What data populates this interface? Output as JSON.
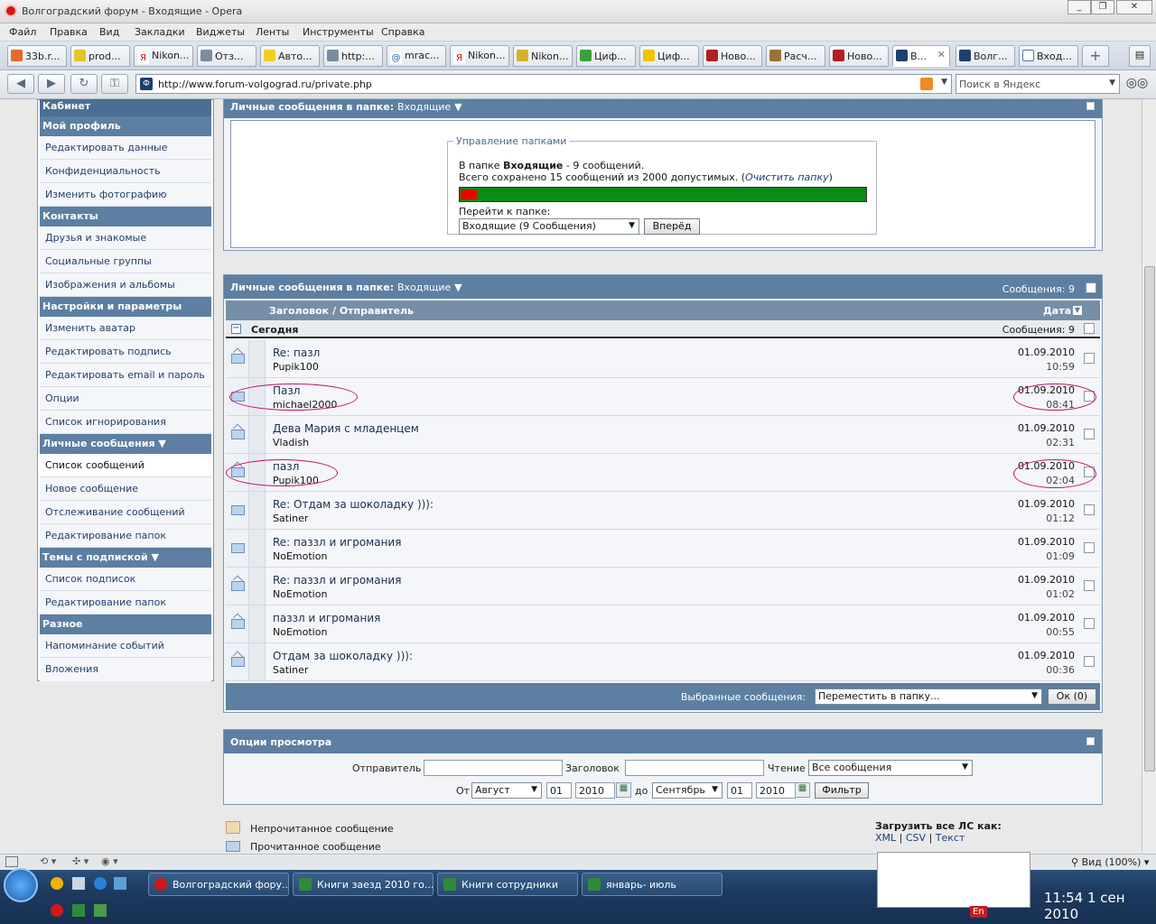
{
  "window": {
    "title": "Волгоградский форум - Входящие - Opera"
  },
  "menu": [
    "Файл",
    "Правка",
    "Вид",
    "Закладки",
    "Виджеты",
    "Ленты",
    "Инструменты",
    "Справка"
  ],
  "tabs": [
    "33b.r...",
    "prod...",
    "Nikon...",
    "Отз...",
    "Авто...",
    "http:...",
    "mrac...",
    "Nikon...",
    "Nikon...",
    "Циф...",
    "Циф...",
    "Ново...",
    "Расч...",
    "Ново...",
    "В...",
    "Волг...",
    "Вход..."
  ],
  "address": {
    "url": "http://www.forum-volgograd.ru/private.php",
    "search_placeholder": "Поиск в Яндекс"
  },
  "sidebar": {
    "sections": [
      {
        "title": "Кабинет"
      },
      {
        "title": "Мой профиль",
        "items": [
          "Редактировать данные",
          "Конфиденциальность",
          "Изменить фотографию"
        ]
      },
      {
        "title": "Контакты",
        "items": [
          "Друзья и знакомые",
          "Социальные группы",
          "Изображения и альбомы"
        ]
      },
      {
        "title": "Настройки и параметры",
        "items": [
          "Изменить аватар",
          "Редактировать подпись",
          "Редактировать email и пароль",
          "Опции",
          "Список игнорирования"
        ]
      },
      {
        "title": "Личные сообщения",
        "items": [
          "Список сообщений",
          "Новое сообщение",
          "Отслеживание сообщений",
          "Редактирование папок"
        ]
      },
      {
        "title": "Темы с подпиской",
        "items": [
          "Список подписок",
          "Редактирование папок"
        ]
      },
      {
        "title": "Разное",
        "items": [
          "Напоминание событий",
          "Вложения"
        ]
      }
    ]
  },
  "folder_mgmt": {
    "header_label": "Личные сообщения в папке:",
    "header_folder": "Входящие",
    "legend": "Управление папками",
    "line1_pre": "В папке ",
    "line1_bold": "Входящие",
    "line1_post": " - 9 сообщений.",
    "line2_pre": "Всего сохранено 15 сообщений из 2000 допустимых. (",
    "line2_link": "Очистить папку",
    "line2_post": ")",
    "usage_fraction": 0.0075,
    "goto_label": "Перейти к папке:",
    "goto_select": "Входящие (9 Сообщения)",
    "goto_button": "Вперёд"
  },
  "messages": {
    "header_label": "Личные сообщения в папке:",
    "header_folder": "Входящие",
    "count_label": "Сообщения: 9",
    "col_title": "Заголовок / Отправитель",
    "col_date": "Дата",
    "group_label": "Сегодня",
    "group_count": "Сообщения: 9",
    "rows": [
      {
        "title": "Re: пазл",
        "sender": "Pupik100",
        "date": "01.09.2010",
        "time": "10:59"
      },
      {
        "title": "Пазл",
        "sender": "michael2000",
        "date": "01.09.2010",
        "time": "08:41"
      },
      {
        "title": "Дева Мария с младенцем",
        "sender": "Vladish",
        "date": "01.09.2010",
        "time": "02:31"
      },
      {
        "title": "пазл",
        "sender": "Pupik100",
        "date": "01.09.2010",
        "time": "02:04"
      },
      {
        "title": "Re: Отдам за шоколадку ))):",
        "sender": "Satiner",
        "date": "01.09.2010",
        "time": "01:12"
      },
      {
        "title": "Re: паззл и игромания",
        "sender": "NoEmotion",
        "date": "01.09.2010",
        "time": "01:09"
      },
      {
        "title": "Re: паззл и игромания",
        "sender": "NoEmotion",
        "date": "01.09.2010",
        "time": "01:02"
      },
      {
        "title": "паззл и игромания",
        "sender": "NoEmotion",
        "date": "01.09.2010",
        "time": "00:55"
      },
      {
        "title": "Отдам за шоколадку ))):",
        "sender": "Satiner",
        "date": "01.09.2010",
        "time": "00:36"
      }
    ],
    "selected_label": "Выбранные сообщения:",
    "selected_select": "Переместить в папку...",
    "ok_button": "Ок (0)"
  },
  "view_opts": {
    "title": "Опции просмотра",
    "sender_label": "Отправитель",
    "subject_label": "Заголовок",
    "read_label": "Чтение",
    "read_select": "Все сообщения",
    "from_label": "От",
    "from_month": "Август",
    "from_day": "01",
    "from_year": "2010",
    "to_label": "до",
    "to_month": "Сентябрь",
    "to_day": "01",
    "to_year": "2010",
    "filter_button": "Фильтр"
  },
  "legend": {
    "unread": "Непрочитанное сообщение",
    "read": "Прочитанное сообщение"
  },
  "export": {
    "title": "Загрузить все ЛС как:",
    "xml": "XML",
    "csv": "CSV",
    "text": "Текст",
    "sep": "|"
  },
  "status": {
    "zoom": "Вид (100%)"
  },
  "taskbar": {
    "buttons": [
      "Волгоградский фору...",
      "Книги заезд 2010 го...",
      "Книги сотрудники",
      "январь- июль"
    ],
    "clock": "11:54 1 сен 2010",
    "lang": "En"
  }
}
